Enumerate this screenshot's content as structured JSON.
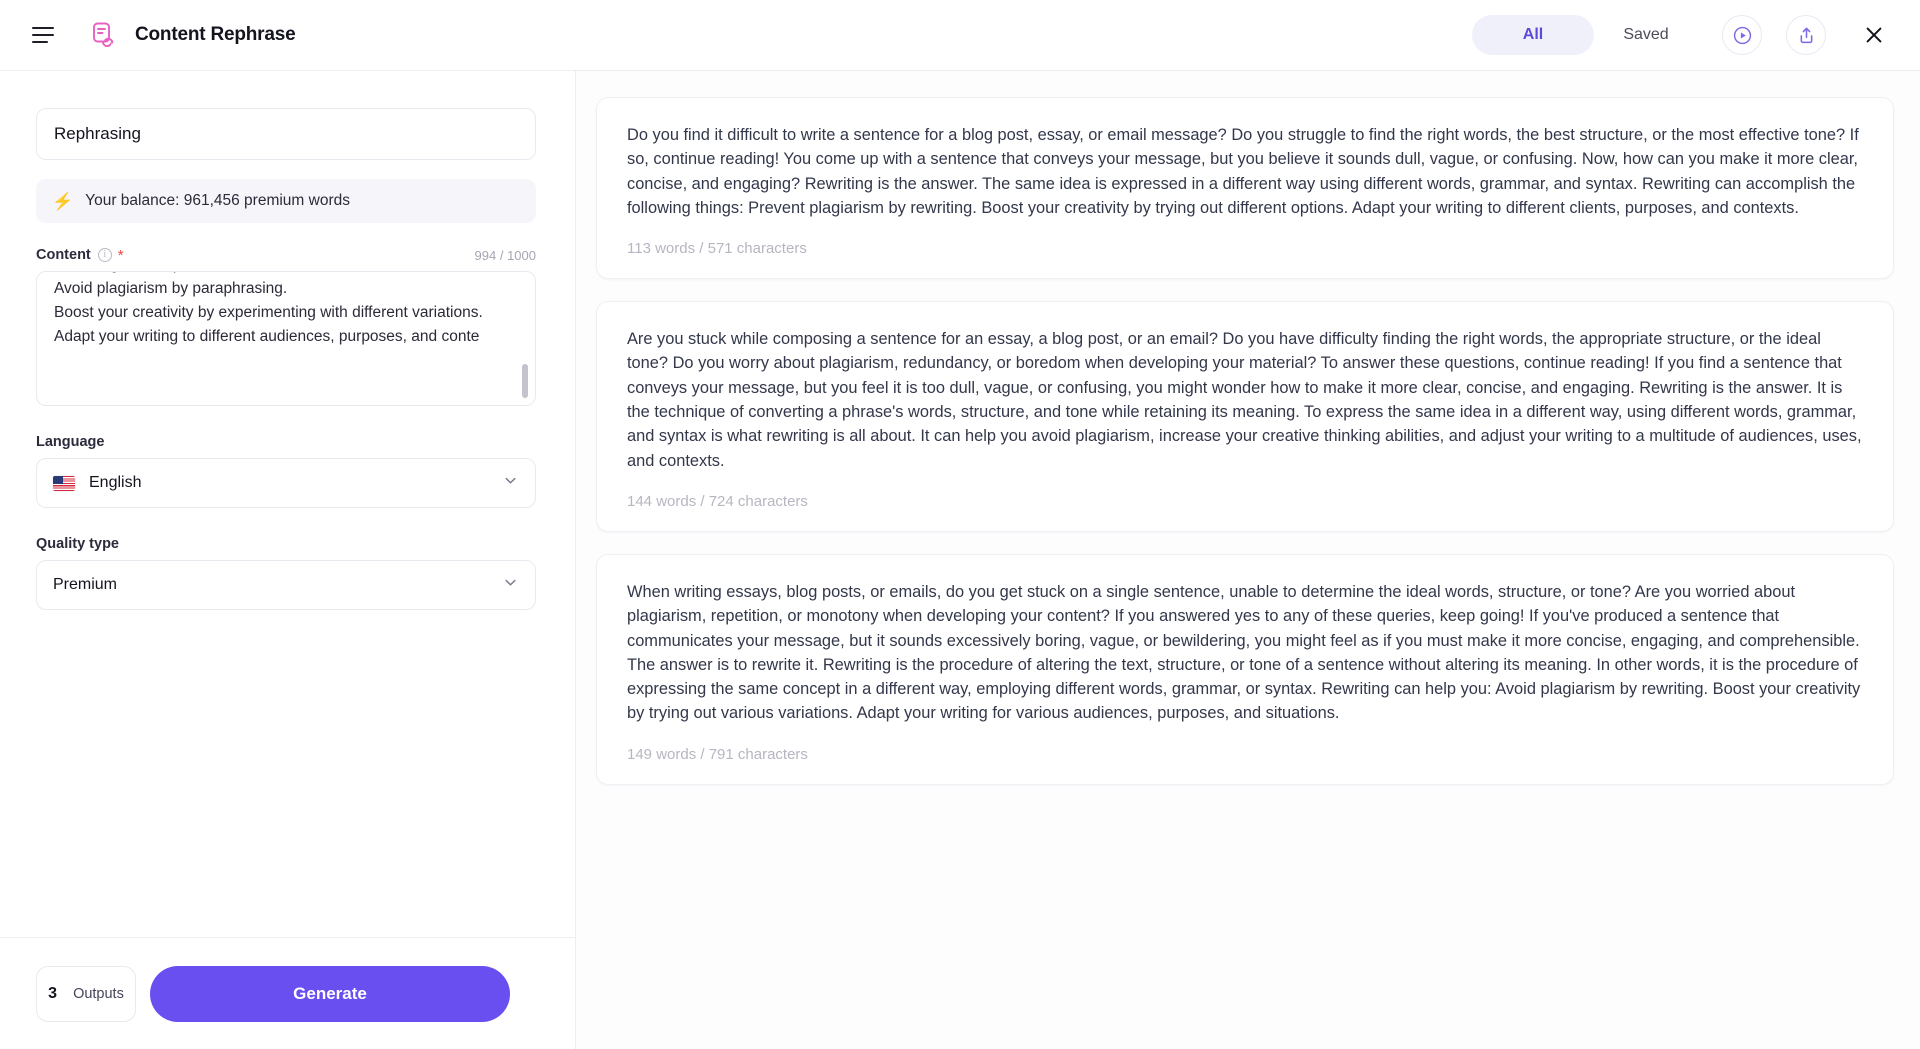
{
  "header": {
    "menu_icon": "hamburger-menu-icon",
    "logo_icon": "content-rephrase-logo-icon",
    "title": "Content Rephrase",
    "tabs": [
      {
        "label": "All",
        "active": true
      },
      {
        "label": "Saved",
        "active": false
      }
    ],
    "actions": [
      {
        "icon": "play-circle-icon"
      },
      {
        "icon": "share-upload-icon"
      },
      {
        "icon": "close-icon"
      }
    ]
  },
  "sidebar": {
    "title_input": {
      "value": "Rephrasing",
      "placeholder": "Title"
    },
    "balance": {
      "icon": "lightning-bolt-icon",
      "text": "Your balance: 961,456 premium words"
    },
    "content_field": {
      "label": "Content",
      "info_icon": "info-icon",
      "required_marker": "*",
      "counter": "994 / 1000",
      "value": "Rewriting can help to:\nAvoid plagiarism by paraphrasing.\nBoost your creativity by experimenting with different variations.\nAdapt your writing to different audiences, purposes, and conte"
    },
    "language_field": {
      "label": "Language",
      "value": "English",
      "flag": "us-flag-icon",
      "chevron": "chevron-down-icon"
    },
    "quality_field": {
      "label": "Quality type",
      "value": "Premium",
      "chevron": "chevron-down-icon"
    }
  },
  "bottom_bar": {
    "outputs_count": "3",
    "outputs_label": "Outputs",
    "generate_label": "Generate"
  },
  "results": [
    {
      "text": "Do you find it difficult to write a sentence for a blog post, essay, or email message? Do you struggle to find the right words, the best structure, or the most effective tone? If so, continue reading! You come up with a sentence that conveys your message, but you believe it sounds dull, vague, or confusing. Now, how can you make it more clear, concise, and engaging? Rewriting is the answer. The same idea is expressed in a different way using different words, grammar, and syntax. Rewriting can accomplish the following things: Prevent plagiarism by rewriting. Boost your creativity by trying out different options. Adapt your writing to different clients, purposes, and contexts.",
      "meta": "113 words / 571 characters"
    },
    {
      "text": "Are you stuck while composing a sentence for an essay, a blog post, or an email? Do you have difficulty finding the right words, the appropriate structure, or the ideal tone? Do you worry about plagiarism, redundancy, or boredom when developing your material? To answer these questions, continue reading! If you find a sentence that conveys your message, but you feel it is too dull, vague, or confusing, you might wonder how to make it more clear, concise, and engaging. Rewriting is the answer. It is the technique of converting a phrase's words, structure, and tone while retaining its meaning. To express the same idea in a different way, using different words, grammar, and syntax is what rewriting is all about. It can help you avoid plagiarism, increase your creative thinking abilities, and adjust your writing to a multitude of audiences, uses, and contexts.",
      "meta": "144 words / 724 characters"
    },
    {
      "text": "When writing essays, blog posts, or emails, do you get stuck on a single sentence, unable to determine the ideal words, structure, or tone? Are you worried about plagiarism, repetition, or monotony when developing your content? If you answered yes to any of these queries, keep going! If you've produced a sentence that communicates your message, but it sounds excessively boring, vague, or bewildering, you might feel as if you must make it more concise, engaging, and comprehensible. The answer is to rewrite it. Rewriting is the procedure of altering the text, structure, or tone of a sentence without altering its meaning. In other words, it is the procedure of expressing the same concept in a different way, employing different words, grammar, or syntax. Rewriting can help you: Avoid plagiarism by rewriting. Boost your creativity by trying out various variations. Adapt your writing for various audiences, purposes, and situations.",
      "meta": "149 words / 791 characters"
    }
  ],
  "colors": {
    "accent": "#6a4ff0",
    "accent_soft": "#f0f0fb",
    "logo": "#e860c0",
    "required": "#f0443c",
    "text": "#14141f",
    "muted": "#b6b6c2"
  }
}
